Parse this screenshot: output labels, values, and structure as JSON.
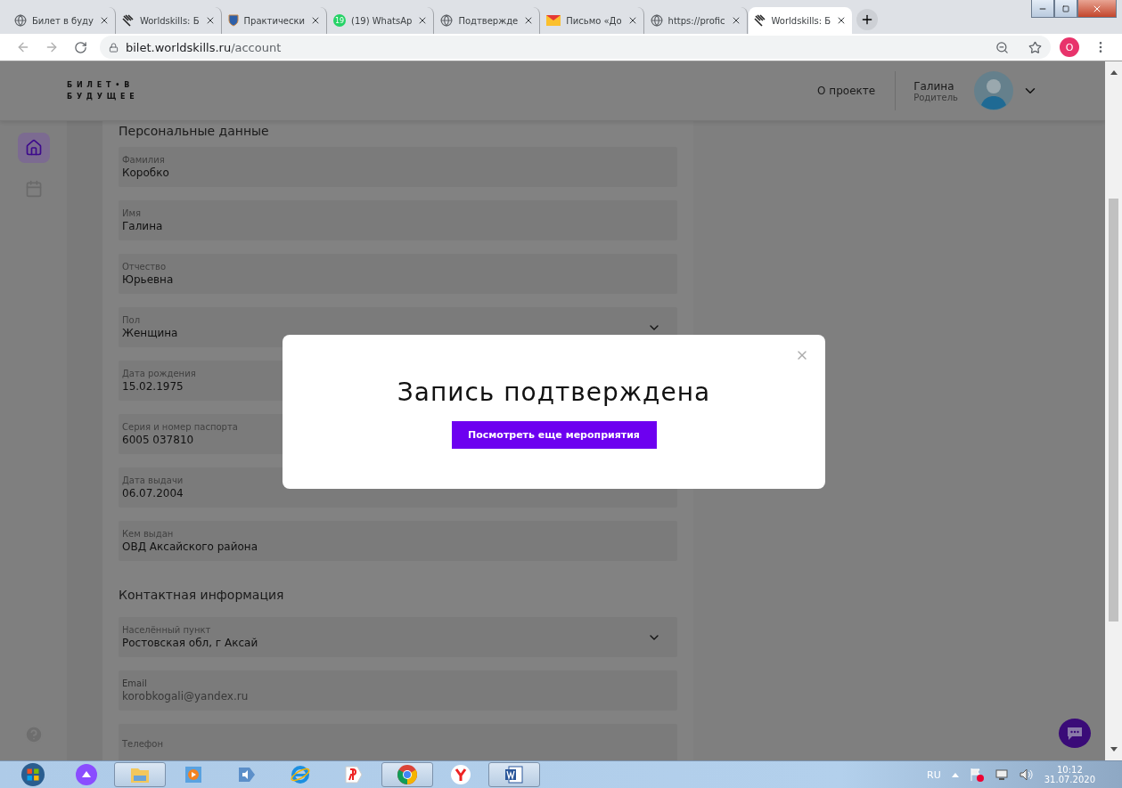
{
  "browser": {
    "tabs": [
      {
        "title": "Билет в буду",
        "kind": "globe",
        "selected": false
      },
      {
        "title": "Worldskills: Б",
        "kind": "bird",
        "selected": false
      },
      {
        "title": "Практически",
        "kind": "shield",
        "selected": false
      },
      {
        "title": "(19) WhatsAp",
        "kind": "badge",
        "badge": "19",
        "selected": false
      },
      {
        "title": "Подтвержде",
        "kind": "globe",
        "selected": false
      },
      {
        "title": "Письмо «До",
        "kind": "mail",
        "selected": false
      },
      {
        "title": "https://profic",
        "kind": "globe",
        "selected": false
      },
      {
        "title": "Worldskills: Б",
        "kind": "bird",
        "selected": true
      }
    ],
    "url_host": "bilet.worldskills.ru",
    "url_path": "/account",
    "profile_initial": "O"
  },
  "header": {
    "logo_line_1": "Б И Л Е Т • В",
    "logo_line_2": "Б У Д У Щ Е Е",
    "nav_link": "О проекте",
    "user_name": "Галина",
    "user_role": "Родитель"
  },
  "sidebar": {
    "items": [
      {
        "kind": "home",
        "selected": true
      },
      {
        "kind": "calendar",
        "selected": false
      }
    ]
  },
  "sections": [
    {
      "title": "Персональные данные",
      "fields": [
        {
          "label": "Фамилия",
          "value": "Коробко",
          "kind": "text",
          "disabled": false
        },
        {
          "label": "Имя",
          "value": "Галина",
          "kind": "text",
          "disabled": false
        },
        {
          "label": "Отчество",
          "value": "Юрьевна",
          "kind": "text",
          "disabled": false
        },
        {
          "label": "Пол",
          "value": "Женщина",
          "kind": "select",
          "disabled": false
        },
        {
          "label": "Дата рождения",
          "value": "15.02.1975",
          "kind": "text",
          "disabled": false
        },
        {
          "label": "Серия и номер паспорта",
          "value": "6005 037810",
          "kind": "text",
          "disabled": false
        },
        {
          "label": "Дата выдачи",
          "value": "06.07.2004",
          "kind": "text",
          "disabled": false
        },
        {
          "label": "Кем выдан",
          "value": "ОВД Аксайского района",
          "kind": "text",
          "disabled": false
        }
      ]
    },
    {
      "title": "Контактная информация",
      "fields": [
        {
          "label": "Населённый пункт",
          "value": "Ростовская обл, г Аксай",
          "kind": "select",
          "disabled": false
        },
        {
          "label": "Email",
          "value": "korobkogali@yandex.ru",
          "kind": "text",
          "disabled": true
        },
        {
          "label": "Телефон",
          "kind": "text",
          "disabled": false
        }
      ]
    }
  ],
  "modal": {
    "title": "Запись подтверждена",
    "button": "Посмотреть еще мероприятия"
  },
  "taskbar": {
    "apps": [
      {
        "kind": "start",
        "selected": false
      },
      {
        "kind": "assistant",
        "selected": false
      },
      {
        "kind": "folder",
        "selected": true
      },
      {
        "kind": "media",
        "selected": false
      },
      {
        "kind": "speaker",
        "selected": false
      },
      {
        "kind": "ie",
        "selected": false
      },
      {
        "kind": "yandex",
        "selected": false
      },
      {
        "kind": "chrome",
        "selected": true
      },
      {
        "kind": "ybrowser",
        "selected": false
      },
      {
        "kind": "word",
        "selected": true
      }
    ],
    "language": "RU",
    "time": "10:12",
    "date": "31.07.2020"
  }
}
